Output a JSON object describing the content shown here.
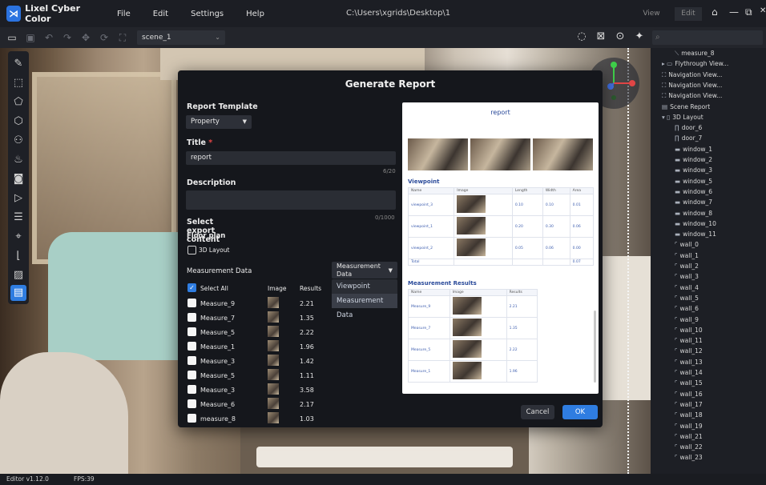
{
  "app": {
    "name": "Lixel Cyber Color",
    "logo_glyph": "⋊",
    "path": "C:\\Users\\xgrids\\Desktop\\1",
    "accent": "#2f7de1"
  },
  "menu": [
    "File",
    "Edit",
    "Settings",
    "Help"
  ],
  "modes": {
    "view": "View",
    "edit": "Edit"
  },
  "toolbar": {
    "scene": "scene_1"
  },
  "dialog": {
    "title": "Generate Report",
    "report_template_label": "Report Template",
    "template_value": "Property",
    "title_label": "Title",
    "title_required": "*",
    "title_value": "report",
    "title_count": "6/20",
    "description_label": "Description",
    "description_count": "0/1000",
    "export_label": "Select export content",
    "floor_plan_label": "Floor plan",
    "layout_3d": "3D Layout",
    "measurement_label": "Measurement Data",
    "measurement_select": "Measurement Data",
    "dropdown_options": [
      "Viewpoint",
      "Measurement Data"
    ],
    "select_all": "Select All",
    "col_image": "Image",
    "col_results": "Results",
    "rows": [
      {
        "name": "Measure_9",
        "result": "2.21"
      },
      {
        "name": "Measure_7",
        "result": "1.35"
      },
      {
        "name": "Measure_5",
        "result": "2.22"
      },
      {
        "name": "Measure_1",
        "result": "1.96"
      },
      {
        "name": "Measure_3",
        "result": "1.42"
      },
      {
        "name": "Measure_5",
        "result": "1.11"
      },
      {
        "name": "Measure_3",
        "result": "3.58"
      },
      {
        "name": "Measure_6",
        "result": "2.17"
      },
      {
        "name": "measure_8",
        "result": "1.03"
      }
    ],
    "cancel": "Cancel",
    "ok": "OK"
  },
  "preview": {
    "title": "report",
    "viewpoint_heading": "Viewpoint",
    "viewpoint_headers": [
      "Name",
      "Image",
      "Length",
      "Width",
      "Area"
    ],
    "viewpoint_rows": [
      {
        "name": "viewpoint_3",
        "length": "0.10",
        "width": "0.10",
        "area": "0.01"
      },
      {
        "name": "viewpoint_1",
        "length": "0.20",
        "width": "0.30",
        "area": "0.06"
      },
      {
        "name": "viewpoint_2",
        "length": "0.05",
        "width": "0.06",
        "area": "0.00"
      }
    ],
    "total_label": "Total",
    "total_value": "0.07",
    "measurement_heading": "Measurement Results",
    "measurement_headers": [
      "Name",
      "Image",
      "Results"
    ],
    "measurement_rows": [
      {
        "name": "Measure_9",
        "result": "2.21"
      },
      {
        "name": "Measure_7",
        "result": "1.35"
      },
      {
        "name": "Measure_5",
        "result": "2.22"
      },
      {
        "name": "Measure_1",
        "result": "1.96"
      }
    ]
  },
  "tree": [
    {
      "label": "measure_8",
      "icon": "measure-icon",
      "glyph": "⟍"
    },
    {
      "label": "Flythrough View...",
      "icon": "folder-icon",
      "glyph": "▸ ▭"
    },
    {
      "label": "Navigation View...",
      "icon": "navigation-icon",
      "glyph": "⛶"
    },
    {
      "label": "Navigation View...",
      "icon": "navigation-icon",
      "glyph": "⛶"
    },
    {
      "label": "Navigation View...",
      "icon": "navigation-icon",
      "glyph": "⛶"
    },
    {
      "label": "Scene Report",
      "icon": "report-icon",
      "glyph": "▤"
    },
    {
      "label": "3D Layout",
      "icon": "layout-icon",
      "glyph": "▾ ▯"
    },
    {
      "label": "door_6",
      "icon": "door-icon",
      "glyph": "∏"
    },
    {
      "label": "door_7",
      "icon": "door-icon",
      "glyph": "∏"
    },
    {
      "label": "window_1",
      "icon": "window-icon",
      "glyph": "▬"
    },
    {
      "label": "window_2",
      "icon": "window-icon",
      "glyph": "▬"
    },
    {
      "label": "window_3",
      "icon": "window-icon",
      "glyph": "▬"
    },
    {
      "label": "window_5",
      "icon": "window-icon",
      "glyph": "▬"
    },
    {
      "label": "window_6",
      "icon": "window-icon",
      "glyph": "▬"
    },
    {
      "label": "window_7",
      "icon": "window-icon",
      "glyph": "▬"
    },
    {
      "label": "window_8",
      "icon": "window-icon",
      "glyph": "▬"
    },
    {
      "label": "window_10",
      "icon": "window-icon",
      "glyph": "▬"
    },
    {
      "label": "window_11",
      "icon": "window-icon",
      "glyph": "▬"
    },
    {
      "label": "wall_0",
      "icon": "wall-icon",
      "glyph": "⌜"
    },
    {
      "label": "wall_1",
      "icon": "wall-icon",
      "glyph": "⌜"
    },
    {
      "label": "wall_2",
      "icon": "wall-icon",
      "glyph": "⌜"
    },
    {
      "label": "wall_3",
      "icon": "wall-icon",
      "glyph": "⌜"
    },
    {
      "label": "wall_4",
      "icon": "wall-icon",
      "glyph": "⌜"
    },
    {
      "label": "wall_5",
      "icon": "wall-icon",
      "glyph": "⌜"
    },
    {
      "label": "wall_6",
      "icon": "wall-icon",
      "glyph": "⌜"
    },
    {
      "label": "wall_9",
      "icon": "wall-icon",
      "glyph": "⌜"
    },
    {
      "label": "wall_10",
      "icon": "wall-icon",
      "glyph": "⌜"
    },
    {
      "label": "wall_11",
      "icon": "wall-icon",
      "glyph": "⌜"
    },
    {
      "label": "wall_12",
      "icon": "wall-icon",
      "glyph": "⌜"
    },
    {
      "label": "wall_13",
      "icon": "wall-icon",
      "glyph": "⌜"
    },
    {
      "label": "wall_14",
      "icon": "wall-icon",
      "glyph": "⌜"
    },
    {
      "label": "wall_15",
      "icon": "wall-icon",
      "glyph": "⌜"
    },
    {
      "label": "wall_16",
      "icon": "wall-icon",
      "glyph": "⌜"
    },
    {
      "label": "wall_17",
      "icon": "wall-icon",
      "glyph": "⌜"
    },
    {
      "label": "wall_18",
      "icon": "wall-icon",
      "glyph": "⌜"
    },
    {
      "label": "wall_19",
      "icon": "wall-icon",
      "glyph": "⌜"
    },
    {
      "label": "wall_21",
      "icon": "wall-icon",
      "glyph": "⌜"
    },
    {
      "label": "wall_22",
      "icon": "wall-icon",
      "glyph": "⌜"
    },
    {
      "label": "wall_23",
      "icon": "wall-icon",
      "glyph": "⌜"
    }
  ],
  "status": {
    "version": "Editor v1.12.0",
    "fps": "FPS:39"
  }
}
